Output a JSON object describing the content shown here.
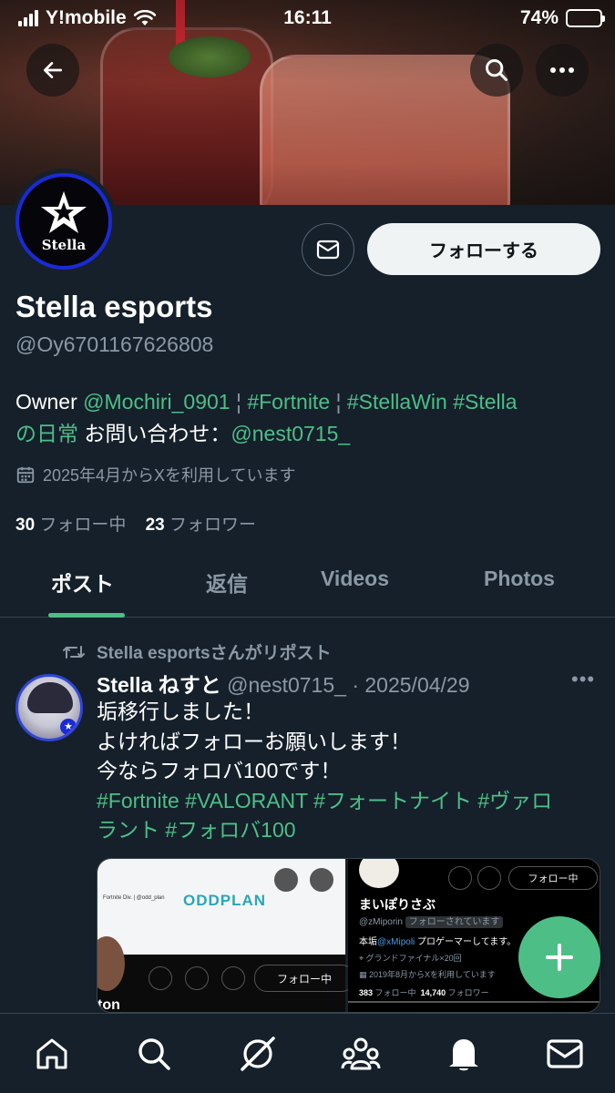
{
  "status_bar": {
    "carrier": "Y!mobile",
    "time": "16:11",
    "battery": "74%",
    "battery_level": 0.74
  },
  "header": {
    "back_icon": "arrow-left-icon",
    "search_icon": "search-icon",
    "more_icon": "more-horizontal-icon"
  },
  "profile": {
    "avatar_text": "Stella",
    "message_icon": "mail-icon",
    "follow_label": "フォローする",
    "name": "Stella esports",
    "handle": "@Oy6701167626808",
    "bio": {
      "owner": "Owner",
      "mention1": "@Mochiri_0901",
      "sep1": "¦",
      "tag1": "#Fortnite",
      "sep2": "¦",
      "tag2": "#StellaWin",
      "tag3": "#Stella",
      "tag3b": "の日常",
      "contact": "お問い合わせ：",
      "mention2": "@nest0715_"
    },
    "joined": "2025年4月からXを利用しています",
    "following_count": "30",
    "following_label": "フォロー中",
    "followers_count": "23",
    "followers_label": "フォロワー"
  },
  "tabs": [
    {
      "label": "ポスト",
      "active": true
    },
    {
      "label": "返信",
      "active": false
    },
    {
      "label": "Videos",
      "active": false
    },
    {
      "label": "Photos",
      "active": false
    }
  ],
  "tweet": {
    "repost_label": "Stella esportsさんがリポスト",
    "author_name": "Stella ねすと",
    "author_handle": "@nest0715_",
    "dot": "·",
    "date": "2025/04/29",
    "more": "•••",
    "lines": [
      "垢移行しました！",
      "よければフォローお願いします！",
      "今ならフォロバ100です！"
    ],
    "hashtags_line1": "#Fortnite #VALORANT #フォートナイト #ヴァロ",
    "hashtags_line2": "ラント #フォロバ100",
    "media": {
      "left": {
        "brand": "ODDPLAN",
        "small_text": "Fortnite Div. | @odd_plan",
        "follow_label": "フォロー中",
        "partial_name": "ton"
      },
      "right": {
        "name": "まいぽりさぶ",
        "handle": "@zMiporin",
        "follows_you": "フォローされています",
        "bio_prefix": "本垢",
        "bio_mention": "@xMipoli",
        "bio_suffix": " プロゲーマーしてます。",
        "location": "グランドファイナル×20回",
        "joined": "2019年8月からXを利用しています",
        "following": "383",
        "following_label": "フォロー中",
        "followers": "14,740",
        "followers_label": "フォロワー",
        "follow_label": "フォロー中"
      }
    }
  },
  "fab": {
    "icon": "plus-icon"
  },
  "bottom_nav": [
    {
      "icon": "home-icon"
    },
    {
      "icon": "search-icon"
    },
    {
      "icon": "grok-icon"
    },
    {
      "icon": "communities-icon"
    },
    {
      "icon": "notifications-bell-icon"
    },
    {
      "icon": "messages-mail-icon"
    }
  ],
  "colors": {
    "background": "#15202b",
    "accent": "#4dbf86",
    "muted": "#8b98a5"
  }
}
